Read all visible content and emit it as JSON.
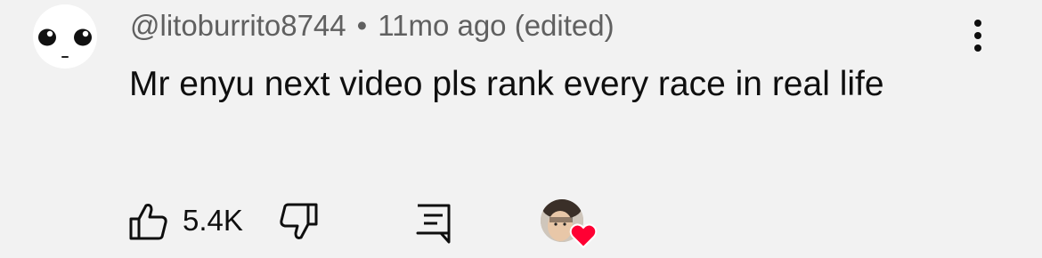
{
  "comment": {
    "author": "@litoburrito8744",
    "separator": "•",
    "time": "11mo ago",
    "edited": "(edited)",
    "text": "Mr enyu next video pls rank every race in real life",
    "likes": "5.4K"
  },
  "icons": {
    "avatar": "cute-face-avatar",
    "menu": "more-vert-icon",
    "like": "thumbs-up-icon",
    "dislike": "thumbs-down-icon",
    "reply": "reply-comment-icon",
    "creator_heart": "creator-heart-icon"
  },
  "colors": {
    "background": "#f2f2f2",
    "text_primary": "#0f0f0f",
    "text_secondary": "#606060",
    "heart": "#ff0033"
  }
}
